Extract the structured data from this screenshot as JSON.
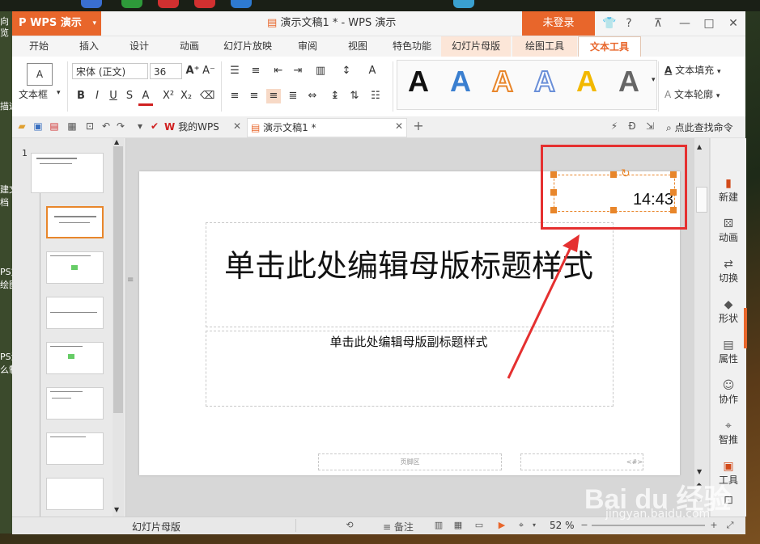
{
  "desktop": {
    "left_labels": [
      "向",
      "览",
      "描述",
      "建文",
      "档",
      "PS文",
      "绘图",
      "PS演",
      "么制"
    ]
  },
  "window": {
    "app_button": "WPS 演示",
    "title": "演示文稿1 * - WPS 演示",
    "login": "未登录",
    "controls": {
      "help": "?",
      "minimize": "—",
      "maximize": "□",
      "close": "✕"
    }
  },
  "ribbon_tabs": [
    "开始",
    "插入",
    "设计",
    "动画",
    "幻灯片放映",
    "审阅",
    "视图",
    "特色功能",
    "幻灯片母版",
    "绘图工具",
    "文本工具"
  ],
  "ribbon": {
    "textbox": "文本框",
    "font_name": "宋体 (正文)",
    "font_size": "36",
    "text_fill": "文本填充",
    "text_outline": "文本轮廓",
    "style_colors": [
      "#111111",
      "#3a7fd0",
      "#e8862b",
      "#6a8fd8",
      "#f2b800",
      "#666666"
    ]
  },
  "quick_tabs": {
    "mywps": "我的WPS",
    "doc": "演示文稿1 *",
    "search": "点此查找命令"
  },
  "thumbs": {
    "first_number": "1"
  },
  "slide": {
    "time": "14:43",
    "title": "单击此处编辑母版标题样式",
    "subtitle": "单击此处编辑母版副标题样式",
    "footer": "页脚区",
    "slide_number": "<#>"
  },
  "right_panel": [
    "新建",
    "动画",
    "切换",
    "形状",
    "属性",
    "协作",
    "智推",
    "工具"
  ],
  "status": {
    "view": "幻灯片母版",
    "notes": "备注",
    "zoom": "52 %"
  },
  "watermark": {
    "brand": "Bai du 经验",
    "url": "jingyan.baidu.com"
  }
}
